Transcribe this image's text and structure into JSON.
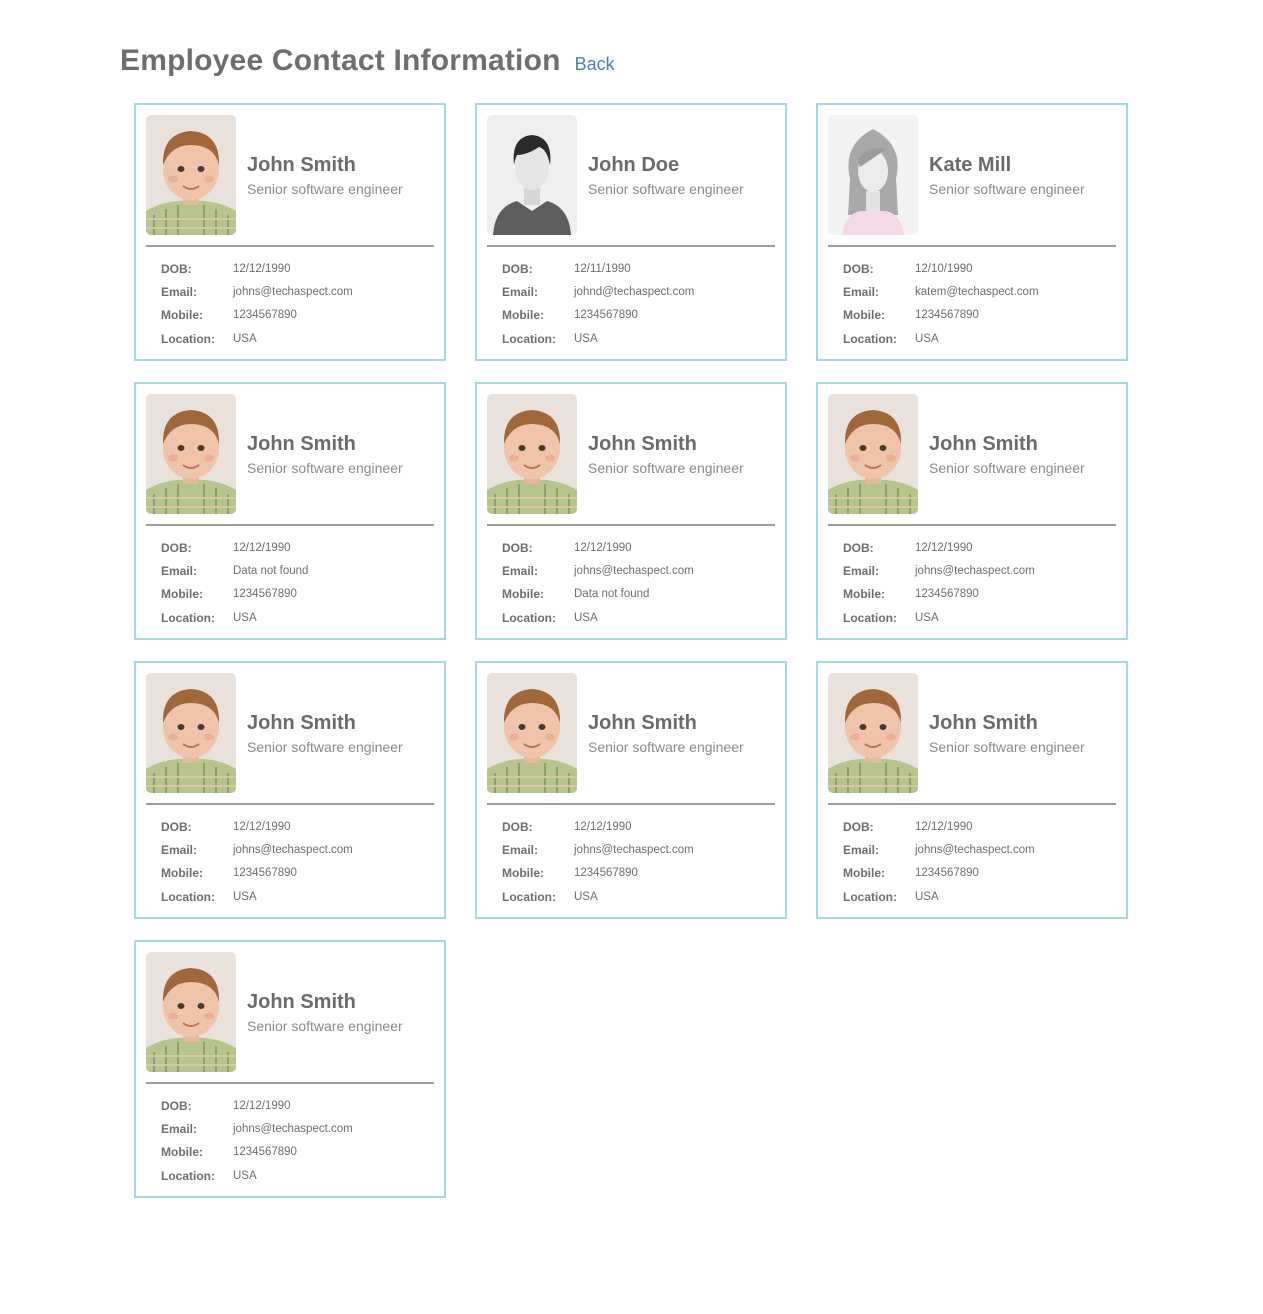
{
  "page": {
    "title": "Employee Contact Information",
    "back_label": "Back"
  },
  "labels": {
    "dob": "DOB:",
    "email": "Email:",
    "mobile": "Mobile:",
    "location": "Location:"
  },
  "colors": {
    "card_border": "#a3d8e4",
    "link": "#4a7fc0",
    "text": "#6b6b6b"
  },
  "employees": [
    {
      "name": "John Smith",
      "title": "Senior software engineer",
      "dob": "12/12/1990",
      "email": "johns@techaspect.com",
      "mobile": "1234567890",
      "location": "USA",
      "photo": "child-photo"
    },
    {
      "name": "John Doe",
      "title": "Senior software engineer",
      "dob": "12/11/1990",
      "email": "johnd@techaspect.com",
      "mobile": "1234567890",
      "location": "USA",
      "photo": "male-placeholder-avatar"
    },
    {
      "name": "Kate Mill",
      "title": "Senior software engineer",
      "dob": "12/10/1990",
      "email": "katem@techaspect.com",
      "mobile": "1234567890",
      "location": "USA",
      "photo": "female-placeholder-avatar"
    },
    {
      "name": "John Smith",
      "title": "Senior software engineer",
      "dob": "12/12/1990",
      "email": "Data not found",
      "mobile": "1234567890",
      "location": "USA",
      "photo": "child-photo"
    },
    {
      "name": "John Smith",
      "title": "Senior software engineer",
      "dob": "12/12/1990",
      "email": "johns@techaspect.com",
      "mobile": "Data not found",
      "location": "USA",
      "photo": "child-photo"
    },
    {
      "name": "John Smith",
      "title": "Senior software engineer",
      "dob": "12/12/1990",
      "email": "johns@techaspect.com",
      "mobile": "1234567890",
      "location": "USA",
      "photo": "child-photo"
    },
    {
      "name": "John Smith",
      "title": "Senior software engineer",
      "dob": "12/12/1990",
      "email": "johns@techaspect.com",
      "mobile": "1234567890",
      "location": "USA",
      "photo": "child-photo"
    },
    {
      "name": "John Smith",
      "title": "Senior software engineer",
      "dob": "12/12/1990",
      "email": "johns@techaspect.com",
      "mobile": "1234567890",
      "location": "USA",
      "photo": "child-photo"
    },
    {
      "name": "John Smith",
      "title": "Senior software engineer",
      "dob": "12/12/1990",
      "email": "johns@techaspect.com",
      "mobile": "1234567890",
      "location": "USA",
      "photo": "child-photo"
    },
    {
      "name": "John Smith",
      "title": "Senior software engineer",
      "dob": "12/12/1990",
      "email": "johns@techaspect.com",
      "mobile": "1234567890",
      "location": "USA",
      "photo": "child-photo"
    }
  ]
}
